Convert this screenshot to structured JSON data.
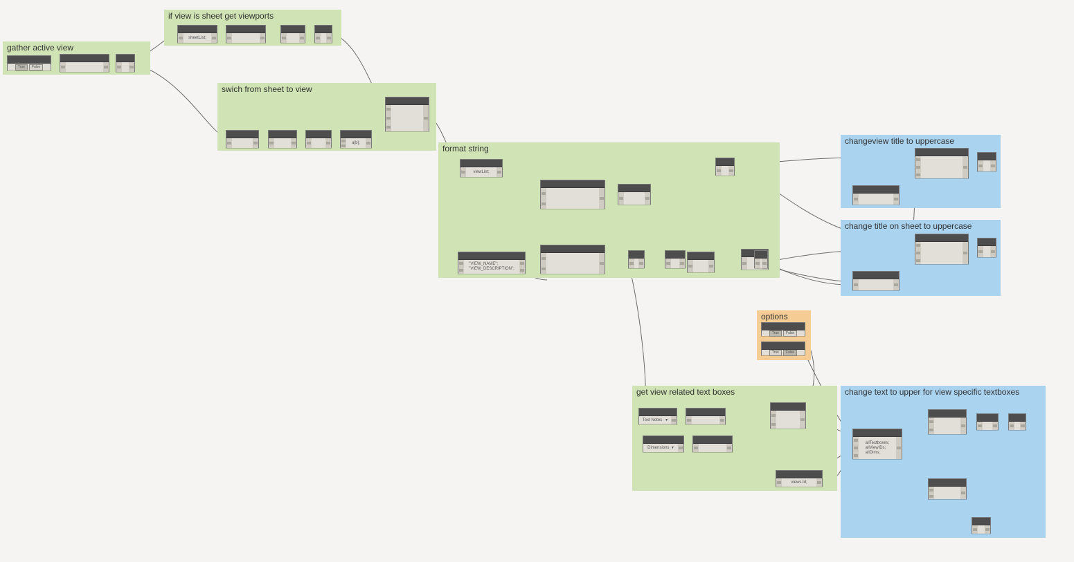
{
  "groups": {
    "gather_active_view": {
      "label": "gather active view"
    },
    "if_view_sheet": {
      "label": "if view is sheet get viewports"
    },
    "switch_sheet_view": {
      "label": "swich from sheet to view"
    },
    "format_string": {
      "label": "format string"
    },
    "options": {
      "label": "options"
    },
    "changeview_title": {
      "label": "changeview title to uppercase"
    },
    "change_title_sheet": {
      "label": "change title on sheet to uppercase"
    },
    "get_view_textboxes": {
      "label": "get view related text boxes"
    },
    "change_text_upper": {
      "label": "change text to upper for view specific textboxes"
    }
  },
  "nodes": {
    "n_bool1": {
      "true": "True",
      "false": "False"
    },
    "n_sheetlist": "sheetList;",
    "n_viewlist": "viewList;",
    "n_viewname": "\"VIEW_NAME\";\n\"VIEW_DESCRIPTION\";",
    "n_ab": "a[b];",
    "n_textnodes": "Text Notes   ▾",
    "n_dimensions": "Dimensions  ▾",
    "n_viewsid": "views.Id;",
    "n_alltextboxes": "allTextboxes;\nallViewIDs;\nallDims;",
    "n_opt_true": "True",
    "n_opt_false": "False"
  }
}
